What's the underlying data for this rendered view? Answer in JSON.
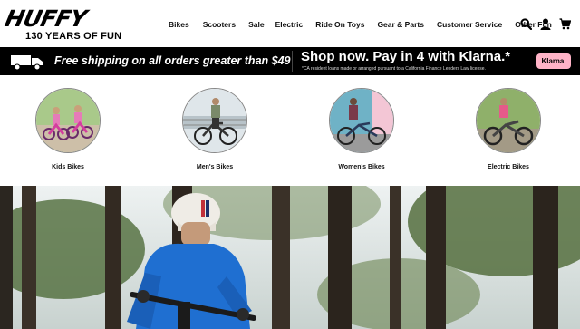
{
  "header": {
    "logo": {
      "wordmark": "HUFFY",
      "tagline": "130 YEARS OF FUN"
    },
    "nav": [
      {
        "label": "Bikes"
      },
      {
        "label": "Scooters"
      },
      {
        "label": "Sale"
      },
      {
        "label": "Electric"
      },
      {
        "label": "Ride On Toys"
      },
      {
        "label": "Gear & Parts"
      },
      {
        "label": "Customer Service"
      },
      {
        "label": "Other Fun"
      }
    ],
    "icons": [
      "search-icon",
      "account-icon",
      "cart-icon"
    ]
  },
  "promo": {
    "shipping_text": "Free shipping on all orders greater than $49",
    "klarna_headline": "Shop now. Pay in 4 with Klarna.*",
    "klarna_disclaimer": "*CA resident loans made or arranged pursuant to a California Finance Lenders Law license.",
    "klarna_badge": "Klarna."
  },
  "categories": [
    {
      "label": "Kids Bikes"
    },
    {
      "label": "Men's Bikes"
    },
    {
      "label": "Women's Bikes"
    },
    {
      "label": "Electric Bikes"
    }
  ],
  "colors": {
    "promo_bg": "#000000",
    "klarna_pink": "#ffb3c7",
    "jacket_blue": "#1f6fd1"
  }
}
